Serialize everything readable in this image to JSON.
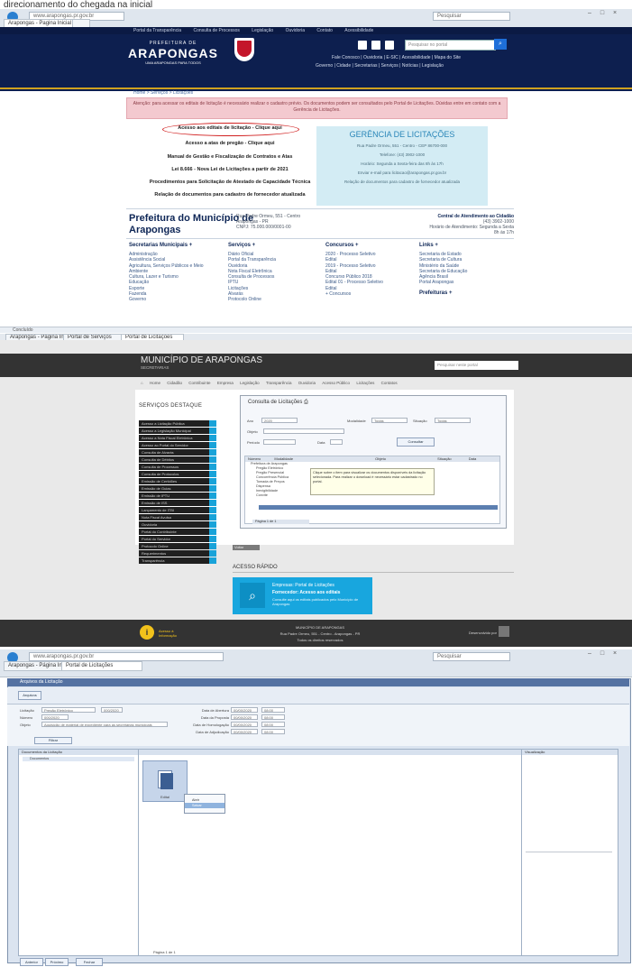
{
  "caption": "direcionamento do chegada na inicial",
  "section1": {
    "tabs": [
      {
        "label": "Arapongas - Pagina Inicial"
      },
      {
        "label": ""
      }
    ],
    "address": "www.arapongas.pr.gov.br",
    "search_placeholder": "Pesquisar",
    "topbar_links": [
      "Portal da Transparência",
      "Consulta de Processos",
      "Legislação",
      "Ouvidoria",
      "Contato",
      "Acessibilidade"
    ],
    "brand": {
      "line1": "PREFEITURA DE",
      "line2": "ARAPONGAS",
      "line3": "UMA ARAPONGAS PARA TODOS"
    },
    "header_search_placeholder": "Pesquisar no portal",
    "header_nav_row1": [
      "Fale Conosco",
      "Ouvidoria",
      "E-SIC",
      "Acessibilidade",
      "Mapa do Site"
    ],
    "header_nav_row2": [
      "Governo",
      "Cidade",
      "Secretarias",
      "Serviços",
      "Notícias",
      "Legislação"
    ],
    "breadcrumb": "Home > Serviços > Licitações",
    "alert": "Atenção: para acessar os editais de licitação é necessário realizar o cadastro prévio. Os documentos podem ser consultados pelo Portal de Licitações. Dúvidas entre em contato com a Gerência de Licitações.",
    "links": [
      "Acesso aos editais de licitação - Clique aqui",
      "Acesso a atas de pregão - Clique aqui",
      "Manual de Gestão e Fiscalização de Contratos e Atas",
      "Lei 8.666 - Nova Lei de Licitações a partir de 2021",
      "Procedimentos para Solicitação de Atestado de Capacidade Técnica",
      "Relação de documentos para cadastro de fornecedor atualizada"
    ],
    "gerencia": {
      "title": "GERÊNCIA DE LICITAÇÕES",
      "lines": [
        "Rua Padre Ormeu, 551 - Centro - CEP 86700-000",
        "Telefone: (43) 3902-1000",
        "Horário: Segunda a Sexta-feira das 8h às 17h",
        "Enviar e-mail para licitacao@arapongas.pr.gov.br",
        "Relação de documentos para cadastro de fornecedor atualizada"
      ]
    },
    "prefeitura": {
      "title1": "Prefeitura do Município de",
      "title2": "Arapongas",
      "info": [
        "Rua Padre Ormeu, 551 - Centro",
        "Arapongas - PR",
        "CNPJ: 75.000.000/0001-00"
      ],
      "central": [
        "Central de Atendimento ao Cidadão",
        "(43) 3902-1000",
        "Horário de Atendimento: Segunda a Sexta",
        "8h às 17h"
      ]
    },
    "columns": [
      {
        "title": "Secretarias Municipais +",
        "items": [
          "Administração",
          "Assistência Social",
          "Agricultura, Serviços Públicos e Meio",
          "Ambiente",
          "Cultura, Lazer e Turismo",
          "Educação",
          "Esporte",
          "Fazenda",
          "Governo"
        ]
      },
      {
        "title": "Serviços +",
        "items": [
          "Diário Oficial",
          "Portal da Transparência",
          "Ouvidoria",
          "Nota Fiscal Eletrônica",
          "Consulta de Processos",
          "IPTU",
          "Licitações",
          "Alvarás",
          "Protocolo Online"
        ]
      },
      {
        "title": "Concursos +",
        "items": [
          "2020 - Processo Seletivo",
          "Edital",
          "2019 - Processo Seletivo",
          "Edital",
          "Concurso Público 2018",
          "Edital 01 - Processo Seletivo",
          "Edital",
          "+ Concursos"
        ]
      },
      {
        "title": "Links +",
        "items": [
          "Secretaria de Estado",
          "Secretaria de Cultura",
          "Ministério da Saúde",
          "Secretaria de Educação",
          "Agência Brasil",
          "Portal Arapongas",
          "Prefeituras +"
        ]
      }
    ],
    "status": "Concluído"
  },
  "section2": {
    "tabs": [
      "Arapongas - Página Inicial",
      "Portal de Serviços",
      "Portal de Licitações"
    ],
    "site_title": "MUNICÍPIO DE ARAPONGAS",
    "site_sub": "SECRETARIAS",
    "search_placeholder": "Pesquisar neste portal",
    "nav": [
      "Home",
      "Cidadão",
      "Contribuinte",
      "Empresa",
      "Legislação",
      "Transparência",
      "Ouvidoria",
      "Acesso Público",
      "Licitações",
      "Contatos"
    ],
    "services_title": "SERVIÇOS DESTAQUE",
    "services": [
      "Acesso a Licitação Pública",
      "Acesso a Legislação Municipal",
      "Acesso a Nota Fiscal Eletrônica",
      "Acesso ao Portal do Servidor",
      "Consulta de Alvarás",
      "Consulta de Débitos",
      "Consulta de Processos",
      "Consulta de Protocolos",
      "Emissão de Certidões",
      "Emissão de Guias",
      "Emissão de IPTU",
      "Emissão de ISS",
      "Lançamento de ITBI",
      "Nota Fiscal Avulsa",
      "Ouvidoria",
      "Portal do Contribuinte",
      "Portal do Servidor",
      "Protocolo Online",
      "Requerimentos",
      "Transparência"
    ],
    "window_title": "Consulta de Licitações",
    "filters": {
      "ano_label": "Ano",
      "ano_value": "2020",
      "modalidade_label": "Modalidade",
      "modalidade_value": "Todas",
      "situacao_label": "Situação",
      "situacao_value": "Todas",
      "objeto_label": "Objeto",
      "periodo_label": "Período",
      "data_label": "Data",
      "button": "Consultar"
    },
    "grid_headers": [
      "Número",
      "Modalidade",
      "Objeto",
      "Situação",
      "Data"
    ],
    "grid_rows": [
      "Prefeitura de Arapongas",
      "Pregão Eletrônico",
      "Pregão Presencial",
      "Concorrência Pública",
      "Tomada de Preços",
      "Dispensa",
      "Inexigibilidade",
      "Convite"
    ],
    "tooltip": "Clique sobre o item para visualizar os documentos disponíveis da licitação selecionada. Para realizar o download é necessário estar cadastrado no portal.",
    "pager": "Página 1 de 1",
    "short_btn": "Voltar",
    "acesso_title": "ACESSO RÁPIDO",
    "blue_box": {
      "line1": "Empresas: Portal de Licitações",
      "line2": "Fornecedor: Acesso aos editais",
      "line3": "Consulte aqui os editais publicados\npelo Município de Arapongas"
    },
    "footer_logo_text": "Acesso à Informação",
    "footer_lines": [
      "MUNICÍPIO DE ARAPONGAS",
      "Rua Padre Ormeu, 551 - Centro - Arapongas - PR",
      "Todos os direitos reservados"
    ],
    "footer_right": "Desenvolvido por"
  },
  "section3": {
    "window_title": "Arquivos da Licitação",
    "toolbar_tab": "Arquivos",
    "form_labels": [
      "Licitação",
      "Número",
      "Objeto"
    ],
    "form_values": [
      "Pregão Eletrônico",
      "000/2020",
      "Aquisição de material de expediente para as secretarias municipais"
    ],
    "date_labels": [
      "Data de Abertura",
      "Data da Proposta",
      "Data de Homologação",
      "Data de Adjudicação"
    ],
    "date_values": [
      "00/00/2020",
      "00/00/2020",
      "00/00/2020",
      "00/00/2020"
    ],
    "date_values2": [
      "08:00",
      "08:00",
      "08:00",
      "08:00"
    ],
    "filter_btn": "Filtrar",
    "tree_header": "Documentos da Licitação",
    "tree_item": "Documentos",
    "file_label": "Edital",
    "ctx_items": [
      "Abrir",
      "Salvar"
    ],
    "preview_label": "Visualização",
    "bottom_buttons": [
      "Anterior",
      "Próximo",
      "Fechar"
    ],
    "pager": "Página 1 de 1"
  }
}
